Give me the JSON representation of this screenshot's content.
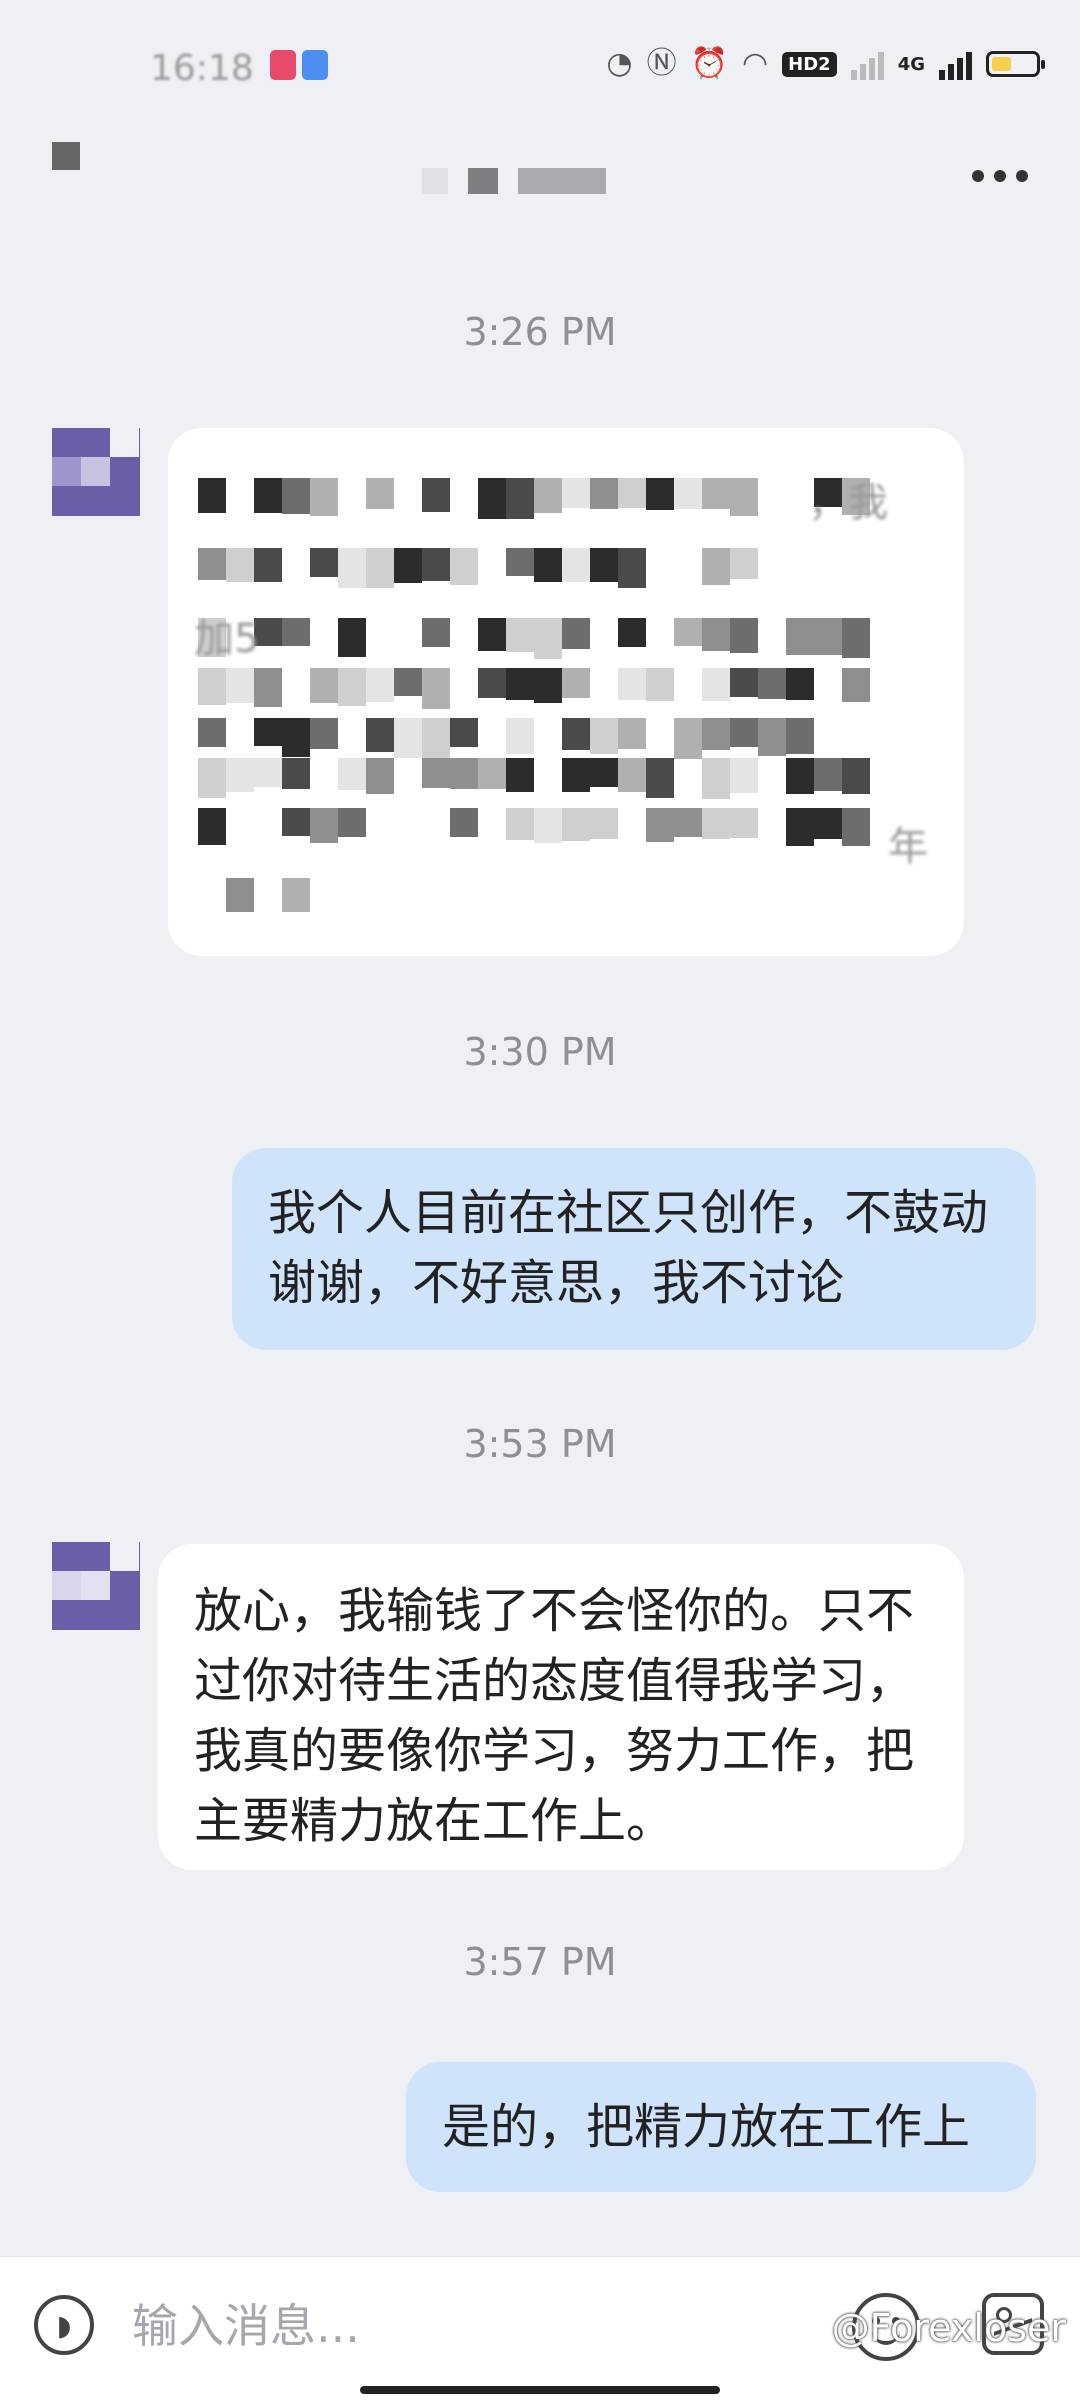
{
  "status_bar": {
    "time": "16:18",
    "network": "4G",
    "hd": "HD2",
    "battery_level": 0.45,
    "icons": [
      "nfc-icon",
      "alarm-icon",
      "wifi-icon",
      "signal-icon",
      "battery-icon"
    ]
  },
  "header": {
    "title": "",
    "back_icon": "back-icon",
    "more_icon": "more-icon"
  },
  "messages": [
    {
      "time": "3:26 PM"
    },
    {
      "side": "left",
      "text": "",
      "visible_fragments": [
        "，我",
        "加5",
        "年"
      ],
      "redacted": true
    },
    {
      "time": "3:30 PM"
    },
    {
      "side": "right",
      "text": "我个人目前在社区只创作，不鼓动谢谢，不好意思，我不讨论"
    },
    {
      "time": "3:53 PM"
    },
    {
      "side": "left",
      "text": "放心，我输钱了不会怪你的。只不过你对待生活的态度值得我学习，我真的要像你学习，努力工作，把主要精力放在工作上。"
    },
    {
      "time": "3:57 PM"
    },
    {
      "side": "right",
      "text": "是的，把精力放在工作上"
    }
  ],
  "input": {
    "placeholder": "输入消息..."
  },
  "watermark": "@Forexloser",
  "colors": {
    "background": "#eef0f4",
    "incoming_bubble": "#ffffff",
    "outgoing_bubble": "#cfe3fb",
    "avatar": "#6a5fa8",
    "timestamp": "#8b8f96",
    "battery_fill": "#f5cf4c"
  }
}
